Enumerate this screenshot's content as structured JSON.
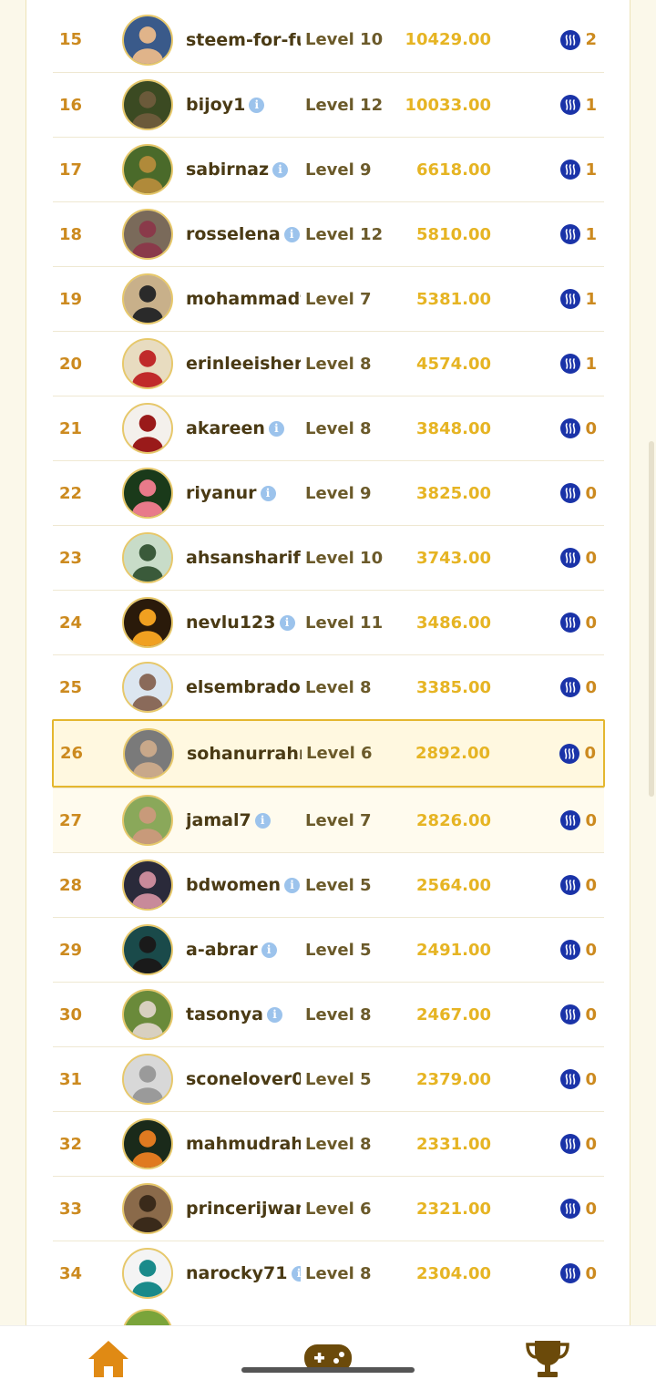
{
  "leaderboard": {
    "rows": [
      {
        "rank": "15",
        "username": "steem-for-future",
        "info": false,
        "level": "Level 10",
        "points": "10429.00",
        "count": "2",
        "avatar": [
          "#3a5a8a",
          "#e0b48a"
        ]
      },
      {
        "rank": "16",
        "username": "bijoy1",
        "info": true,
        "level": "Level 12",
        "points": "10033.00",
        "count": "1",
        "avatar": [
          "#3b4a22",
          "#6b5a3a"
        ]
      },
      {
        "rank": "17",
        "username": "sabirnaz",
        "info": true,
        "level": "Level 9",
        "points": "6618.00",
        "count": "1",
        "avatar": [
          "#4a6a2a",
          "#b08a3a"
        ]
      },
      {
        "rank": "18",
        "username": "rosselena",
        "info": true,
        "level": "Level 12",
        "points": "5810.00",
        "count": "1",
        "avatar": [
          "#7a6a5a",
          "#8a3a4a"
        ]
      },
      {
        "rank": "19",
        "username": "mohammadfaisal",
        "info": false,
        "level": "Level 7",
        "points": "5381.00",
        "count": "1",
        "avatar": [
          "#c8b08a",
          "#2a2a2a"
        ]
      },
      {
        "rank": "20",
        "username": "erinleeisherelcome",
        "info": false,
        "level": "Level 8",
        "points": "4574.00",
        "count": "1",
        "avatar": [
          "#e8dcc0",
          "#c02a2a"
        ]
      },
      {
        "rank": "21",
        "username": "akareen",
        "info": true,
        "level": "Level 8",
        "points": "3848.00",
        "count": "0",
        "avatar": [
          "#f4f0ec",
          "#9a1a1a"
        ]
      },
      {
        "rank": "22",
        "username": "riyanur",
        "info": true,
        "level": "Level 9",
        "points": "3825.00",
        "count": "0",
        "avatar": [
          "#1a3a1a",
          "#e87a8a"
        ]
      },
      {
        "rank": "23",
        "username": "ahsansharif",
        "info": false,
        "level": "Level 10",
        "points": "3743.00",
        "count": "0",
        "avatar": [
          "#c8dcc8",
          "#3a5a3a"
        ]
      },
      {
        "rank": "24",
        "username": "nevlu123",
        "info": true,
        "level": "Level 11",
        "points": "3486.00",
        "count": "0",
        "avatar": [
          "#2a1a0a",
          "#f0a020"
        ]
      },
      {
        "rank": "25",
        "username": "elsembrador",
        "info": false,
        "level": "Level 8",
        "points": "3385.00",
        "count": "0",
        "avatar": [
          "#dce6f0",
          "#8a6a5a"
        ]
      },
      {
        "rank": "26",
        "username": "sohanurrahman",
        "info": false,
        "level": "Level 6",
        "points": "2892.00",
        "count": "0",
        "avatar": [
          "#7a7a7a",
          "#c8a88a"
        ]
      },
      {
        "rank": "27",
        "username": "jamal7",
        "info": true,
        "level": "Level 7",
        "points": "2826.00",
        "count": "0",
        "avatar": [
          "#8aa85a",
          "#c89a7a"
        ]
      },
      {
        "rank": "28",
        "username": "bdwomen",
        "info": true,
        "level": "Level 5",
        "points": "2564.00",
        "count": "0",
        "avatar": [
          "#2a2a3a",
          "#c88a9a"
        ]
      },
      {
        "rank": "29",
        "username": "a-abrar",
        "info": true,
        "level": "Level 5",
        "points": "2491.00",
        "count": "0",
        "avatar": [
          "#1a4a4a",
          "#1a1a1a"
        ]
      },
      {
        "rank": "30",
        "username": "tasonya",
        "info": true,
        "level": "Level 8",
        "points": "2467.00",
        "count": "0",
        "avatar": [
          "#6a8a3a",
          "#d8d0c0"
        ]
      },
      {
        "rank": "31",
        "username": "sconelover0",
        "info": false,
        "level": "Level 5",
        "points": "2379.00",
        "count": "0",
        "avatar": [
          "#d8d8d8",
          "#9a9a9a"
        ]
      },
      {
        "rank": "32",
        "username": "mahmudrahman",
        "info": false,
        "level": "Level 8",
        "points": "2331.00",
        "count": "0",
        "avatar": [
          "#1a2a1a",
          "#e07a20"
        ]
      },
      {
        "rank": "33",
        "username": "princerijwan",
        "info": false,
        "level": "Level 6",
        "points": "2321.00",
        "count": "0",
        "avatar": [
          "#8a6a4a",
          "#3a2a1a"
        ]
      },
      {
        "rank": "34",
        "username": "narocky71",
        "info": true,
        "level": "Level 8",
        "points": "2304.00",
        "count": "0",
        "avatar": [
          "#f4f4f4",
          "#1a8a8a"
        ]
      }
    ],
    "highlighted_rank": "26"
  },
  "nav": {
    "items": [
      {
        "name": "home",
        "icon": "home-icon",
        "active": true
      },
      {
        "name": "games",
        "icon": "gamepad-icon",
        "active": false
      },
      {
        "name": "leaderboard",
        "icon": "trophy-icon",
        "active": false
      }
    ]
  },
  "colors": {
    "accent": "#cc8a1f",
    "points": "#e6b423",
    "steem": "#1a33a8",
    "highlight_border": "#e4b72f",
    "nav_active": "#e08a14",
    "nav_trophy": "#6b4a0a"
  }
}
